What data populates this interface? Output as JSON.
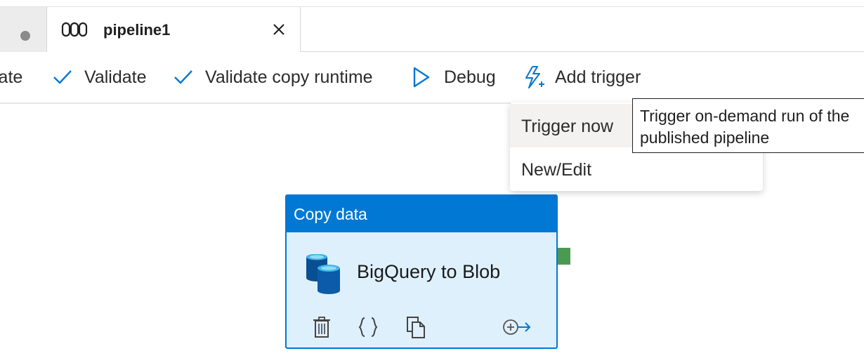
{
  "tabs": {
    "prev_tab_indicator": "unsaved-dot",
    "active_tab": {
      "title": "pipeline1",
      "icon": "pipeline-icon",
      "close_icon": "close-icon"
    }
  },
  "toolbar": {
    "items": [
      {
        "label": "late",
        "icon": null
      },
      {
        "label": "Validate",
        "icon": "checkmark-icon"
      },
      {
        "label": "Validate copy runtime",
        "icon": "checkmark-icon"
      },
      {
        "label": "Debug",
        "icon": "play-icon"
      },
      {
        "label": "Add trigger",
        "icon": "trigger-icon"
      }
    ],
    "accent_color": "#0078d4"
  },
  "trigger_menu": {
    "items": [
      {
        "label": "Trigger now",
        "hovered": true
      },
      {
        "label": "New/Edit",
        "hovered": false
      }
    ]
  },
  "tooltip": {
    "lines": [
      "Trigger on-demand run of the",
      "published pipeline"
    ]
  },
  "activity": {
    "type": "Copy data",
    "name": "BigQuery to Blob",
    "icon": "database-icon",
    "actions": [
      "delete-icon",
      "code-icon",
      "clone-icon",
      "add-output-icon"
    ],
    "header_color": "#0078d4",
    "body_color": "#dff0fd",
    "success_port_color": "#4c9a52"
  }
}
